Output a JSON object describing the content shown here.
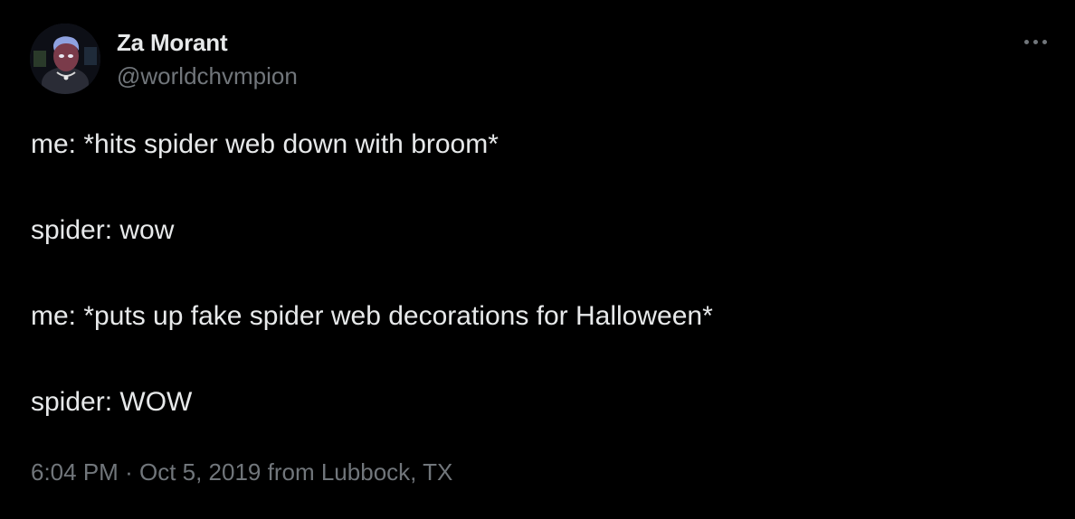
{
  "author": {
    "display_name": "Za Morant",
    "handle": "@worldchvmpion"
  },
  "tweet": {
    "lines": [
      "me: *hits spider web down with broom*",
      "spider: wow",
      "me: *puts up fake spider web decorations for Halloween*",
      "spider: WOW"
    ],
    "time": "6:04 PM",
    "separator": "·",
    "date": "Oct 5, 2019",
    "source": "from Lubbock, TX"
  },
  "icons": {
    "more": "more-horizontal-icon",
    "avatar": "avatar"
  },
  "colors": {
    "background": "#000000",
    "primary_text": "#e7e9ea",
    "secondary_text": "#71767b"
  }
}
